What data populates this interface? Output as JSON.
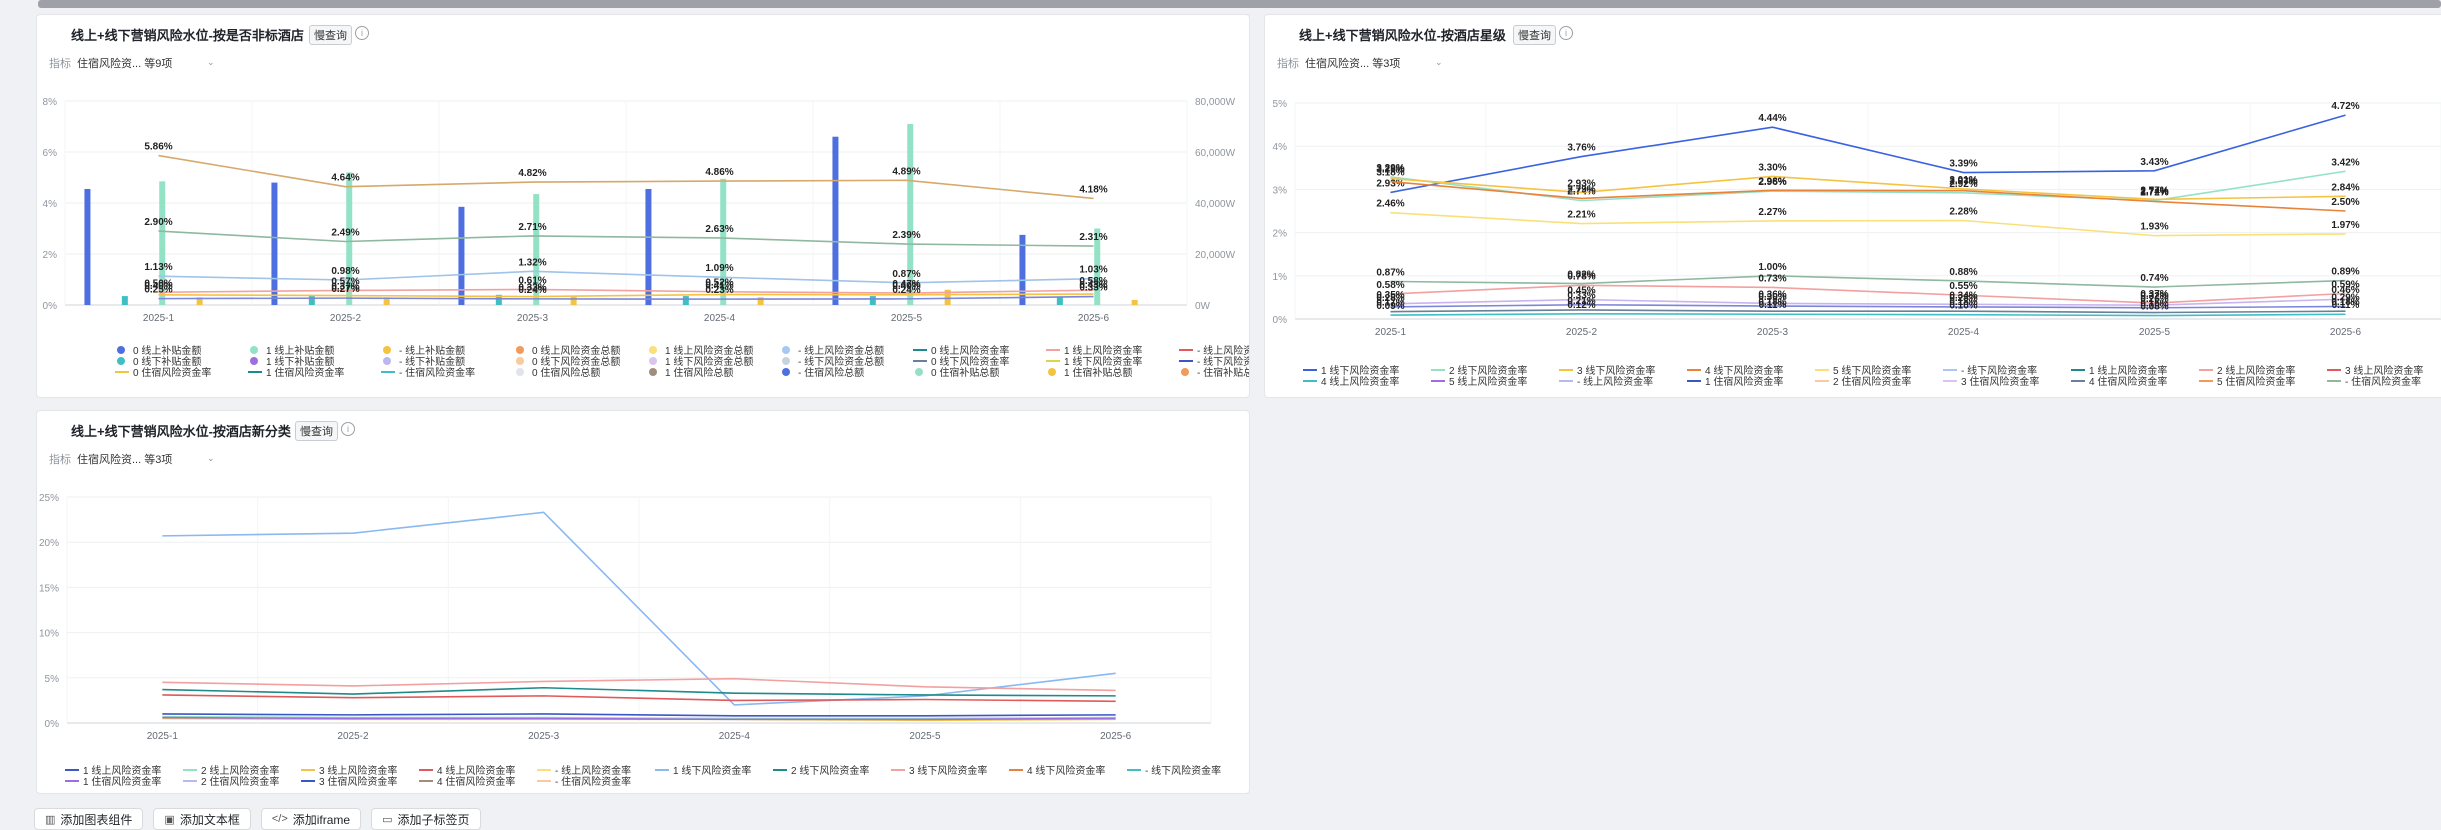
{
  "panels": [
    {
      "title": "线上+线下营销风险水位-按是否非标酒店",
      "badge": "慢查询",
      "filter_label": "指标",
      "filter_value": "住宿风险资... 等9项",
      "chart_data": {
        "type": "bar",
        "categories": [
          "2025-1",
          "2025-2",
          "2025-3",
          "2025-4",
          "2025-5",
          "2025-6"
        ],
        "ylim": [
          0,
          8
        ],
        "yticks": [
          "0%",
          "2%",
          "4%",
          "6%",
          "8%"
        ],
        "y2lim": [
          0,
          80000
        ],
        "y2ticks": [
          "0W",
          "20,000W",
          "40,000W",
          "60,000W",
          "80,000W"
        ],
        "bar_series": [
          {
            "name": "0 线上补贴金额",
            "color": "#4e6fe0",
            "values": [
              45500,
              48000,
              38500,
              45500,
              66000,
              27500
            ]
          },
          {
            "name": "0 线下补贴金额",
            "color": "#3fbfc4",
            "values": [
              3500,
              3500,
              4000,
              3500,
              3500,
              3000
            ]
          },
          {
            "name": "1 线上补贴金额",
            "color": "#93e2c6",
            "values": [
              48500,
              52000,
              43500,
              49500,
              71000,
              30000
            ]
          },
          {
            "name": "1 线下补贴金额",
            "color": "#f5c342",
            "values": [
              3000,
              3000,
              3500,
              3000,
              6000,
              2000
            ]
          }
        ],
        "line_series": [
          {
            "name": "住宿风险资金率",
            "color": "#d6a86a",
            "values": [
              5.86,
              4.64,
              4.82,
              4.86,
              4.89,
              4.18
            ],
            "labels": [
              "5.86%",
              "4.64%",
              "4.82%",
              "4.86%",
              "4.89%",
              "4.18%"
            ]
          },
          {
            "name": "1 线上风险资金率",
            "color": "#8fb89f",
            "values": [
              2.9,
              2.49,
              2.71,
              2.63,
              2.39,
              2.31
            ],
            "labels": [
              "2.90%",
              "2.49%",
              "2.71%",
              "2.63%",
              "2.39%",
              "2.31%"
            ]
          },
          {
            "name": "0 线上风险资金率",
            "color": "#9fc3ea",
            "values": [
              1.13,
              0.98,
              1.32,
              1.09,
              0.87,
              1.03
            ],
            "labels": [
              "1.13%",
              "0.98%",
              "1.32%",
              "1.09%",
              "0.87%",
              "1.03%"
            ]
          },
          {
            "name": "- 线上风险资金率",
            "color": "#f2a0a0",
            "values": [
              0.5,
              0.57,
              0.61,
              0.52,
              0.47,
              0.58
            ],
            "labels": [
              "0.50%",
              "0.57%",
              "0.61%",
              "0.52%",
              "0.47%",
              "0.58%"
            ]
          },
          {
            "name": "住宿风险资金率",
            "color": "#f5c342",
            "values": [
              0.4,
              0.37,
              0.33,
              0.41,
              0.4,
              0.43
            ],
            "labels": [
              "0.40%",
              "0.37%",
              "0.33%",
              "0.41%",
              "0.40%",
              "0.43%"
            ]
          },
          {
            "name": "- 线下风险资金率",
            "color": "#7b86d9",
            "values": [
              0.25,
              0.27,
              0.24,
              0.23,
              0.24,
              0.33
            ],
            "labels": [
              "0.25%",
              "0.27%",
              "0.24%",
              "0.23%",
              "0.24%",
              "0.33%"
            ]
          }
        ],
        "legend": [
          {
            "name": "0 线上补贴金额",
            "color": "#4e6fe0",
            "shape": "dot"
          },
          {
            "name": "1 线上补贴金额",
            "color": "#93e2c6",
            "shape": "dot"
          },
          {
            "name": "- 线上补贴金额",
            "color": "#f5c342",
            "shape": "dot"
          },
          {
            "name": "0 线上风险资金总额",
            "color": "#f29a5a",
            "shape": "dot"
          },
          {
            "name": "1 线上风险资金总额",
            "color": "#f9e07a",
            "shape": "dot"
          },
          {
            "name": "- 线上风险资金总额",
            "color": "#a8c7f5",
            "shape": "dot"
          },
          {
            "name": "0 线上风险资金率",
            "color": "#1f8a8a",
            "shape": "line"
          },
          {
            "name": "1 线上风险资金率",
            "color": "#f2a0a0",
            "shape": "line"
          },
          {
            "name": "- 线上风险资金率",
            "color": "#e05a5a",
            "shape": "line"
          },
          {
            "name": "0 线下补贴金额",
            "color": "#3fbfc4",
            "shape": "dot"
          },
          {
            "name": "1 线下补贴金额",
            "color": "#9b6fe0",
            "shape": "dot"
          },
          {
            "name": "- 线下补贴金额",
            "color": "#bdb7f0",
            "shape": "dot"
          },
          {
            "name": "0 线下风险资金总额",
            "color": "#f9c9a0",
            "shape": "dot"
          },
          {
            "name": "1 线下风险资金总额",
            "color": "#d8c6f0",
            "shape": "dot"
          },
          {
            "name": "- 线下风险资金总额",
            "color": "#c9d3e0",
            "shape": "dot"
          },
          {
            "name": "0 线下风险资金率",
            "color": "#6a7f99",
            "shape": "line"
          },
          {
            "name": "1 线下风险资金率",
            "color": "#e0d24a",
            "shape": "line"
          },
          {
            "name": "- 线下风险资金率",
            "color": "#3a57c4",
            "shape": "line"
          },
          {
            "name": "0 住宿风险资金率",
            "color": "#f5c342",
            "shape": "line"
          },
          {
            "name": "1 住宿风险资金率",
            "color": "#1f8a8a",
            "shape": "line"
          },
          {
            "name": "- 住宿风险资金率",
            "color": "#3fbfc4",
            "shape": "line"
          },
          {
            "name": "0 住宿风险总额",
            "color": "#e0e3e8",
            "shape": "dot"
          },
          {
            "name": "1 住宿风险总额",
            "color": "#a08e7a",
            "shape": "dot"
          },
          {
            "name": "- 住宿风险总额",
            "color": "#4e6fe0",
            "shape": "dot"
          },
          {
            "name": "0 住宿补贴总额",
            "color": "#93e2c6",
            "shape": "dot"
          },
          {
            "name": "1 住宿补贴总额",
            "color": "#f5c342",
            "shape": "dot"
          },
          {
            "name": "- 住宿补贴总额",
            "color": "#f29a5a",
            "shape": "dot"
          }
        ]
      }
    },
    {
      "title": "线上+线下营销风险水位-按酒店星级",
      "badge": "慢查询",
      "filter_label": "指标",
      "filter_value": "住宿风险资... 等3项",
      "chart_data": {
        "type": "line",
        "categories": [
          "2025-1",
          "2025-2",
          "2025-3",
          "2025-4",
          "2025-5",
          "2025-6"
        ],
        "ylim": [
          0,
          5
        ],
        "yticks": [
          "0%",
          "1%",
          "2%",
          "3%",
          "4%",
          "5%"
        ],
        "series": [
          {
            "name": "1 线下风险资金率",
            "color": "#3a62e0",
            "values": [
              2.93,
              3.76,
              4.44,
              3.39,
              3.43,
              4.72
            ],
            "labels": [
              "2.93%",
              "3.76%",
              "4.44%",
              "3.39%",
              "3.43%",
              "4.72%"
            ]
          },
          {
            "name": "2 线下风险资金率",
            "color": "#93e2c6",
            "values": [
              3.29,
              2.74,
              2.96,
              2.92,
              2.74,
              3.42
            ],
            "labels": [
              "3.29%",
              "2.74%",
              "2.96%",
              "2.92%",
              "2.74%",
              "3.42%"
            ]
          },
          {
            "name": "3 线下风险资金率",
            "color": "#f5c342",
            "values": [
              3.25,
              2.93,
              3.3,
              3.01,
              2.77,
              2.84
            ],
            "labels": [
              "3.25%",
              "2.93%",
              "3.30%",
              "3.01%",
              "2.77%",
              "2.84%"
            ]
          },
          {
            "name": "4 线下风险资金率",
            "color": "#e8833a",
            "values": [
              3.18,
              2.79,
              2.98,
              2.97,
              2.72,
              2.5
            ],
            "labels": [
              "3.18%",
              "2.79%",
              "2.98%",
              "2.97%",
              "2.72%",
              "2.50%"
            ]
          },
          {
            "name": "5 线下风险资金率",
            "color": "#f9e07a",
            "values": [
              2.46,
              2.21,
              2.27,
              2.28,
              1.93,
              1.97
            ],
            "labels": [
              "2.46%",
              "2.21%",
              "2.27%",
              "2.28%",
              "1.93%",
              "1.97%"
            ]
          },
          {
            "name": "1 住宿风险资金率",
            "color": "#8fb89f",
            "values": [
              0.87,
              0.82,
              1.0,
              0.88,
              0.74,
              0.89
            ],
            "labels": [
              "0.87%",
              "0.82%",
              "1.00%",
              "0.88%",
              "0.74%",
              "0.89%"
            ]
          },
          {
            "name": "2 住宿风险资金率",
            "color": "#f2a0a0",
            "values": [
              0.58,
              0.78,
              0.73,
              0.55,
              0.37,
              0.59
            ],
            "labels": [
              "0.58%",
              "0.78%",
              "0.73%",
              "0.55%",
              "0.37%",
              "0.59%"
            ]
          },
          {
            "name": "3 住宿风险资金率",
            "color": "#c9b3f0",
            "values": [
              0.35,
              0.45,
              0.36,
              0.34,
              0.32,
              0.46
            ],
            "labels": [
              "0.35%",
              "0.45%",
              "0.36%",
              "0.34%",
              "0.32%",
              "0.46%"
            ]
          },
          {
            "name": "4 住宿风险资金率",
            "color": "#7b86d9",
            "values": [
              0.28,
              0.33,
              0.3,
              0.28,
              0.26,
              0.29
            ],
            "labels": [
              "0.28%",
              "0.33%",
              "0.30%",
              "0.28%",
              "0.26%",
              "0.29%"
            ]
          },
          {
            "name": "5 住宿风险资金率",
            "color": "#6a7f99",
            "values": [
              0.17,
              0.21,
              0.18,
              0.18,
              0.15,
              0.18
            ],
            "labels": [
              "0.17%",
              "0.21%",
              "0.18%",
              "0.18%",
              "0.15%",
              "0.18%"
            ]
          },
          {
            "name": "- 住宿风险资金率",
            "color": "#3fbfc4",
            "values": [
              0.09,
              0.12,
              0.11,
              0.1,
              0.08,
              0.11
            ],
            "labels": [
              "0.09%",
              "0.12%",
              "0.11%",
              "0.10%",
              "0.08%",
              "0.11%"
            ]
          }
        ],
        "legend": [
          {
            "name": "1 线下风险资金率",
            "color": "#3a62e0"
          },
          {
            "name": "2 线下风险资金率",
            "color": "#93e2c6"
          },
          {
            "name": "3 线下风险资金率",
            "color": "#f5c342"
          },
          {
            "name": "4 线下风险资金率",
            "color": "#e8833a"
          },
          {
            "name": "5 线下风险资金率",
            "color": "#f9e07a"
          },
          {
            "name": "- 线下风险资金率",
            "color": "#a8c7f5"
          },
          {
            "name": "1 线上风险资金率",
            "color": "#1f8a8a"
          },
          {
            "name": "2 线上风险资金率",
            "color": "#f2a0a0"
          },
          {
            "name": "3 线上风险资金率",
            "color": "#e05a5a"
          },
          {
            "name": "4 线上风险资金率",
            "color": "#3fbfc4"
          },
          {
            "name": "5 线上风险资金率",
            "color": "#9b6fe0"
          },
          {
            "name": "- 线上风险资金率",
            "color": "#bdb7f0"
          },
          {
            "name": "1 住宿风险资金率",
            "color": "#3a57c4"
          },
          {
            "name": "2 住宿风险资金率",
            "color": "#f9c9a0"
          },
          {
            "name": "3 住宿风险资金率",
            "color": "#d8c6f0"
          },
          {
            "name": "4 住宿风险资金率",
            "color": "#6a7f99"
          },
          {
            "name": "5 住宿风险资金率",
            "color": "#f29a5a"
          },
          {
            "name": "- 住宿风险资金率",
            "color": "#8fb89f"
          }
        ]
      }
    },
    {
      "title": "线上+线下营销风险水位-按酒店新分类",
      "badge": "慢查询",
      "filter_label": "指标",
      "filter_value": "住宿风险资... 等3项",
      "chart_data": {
        "type": "line",
        "categories": [
          "2025-1",
          "2025-2",
          "2025-3",
          "2025-4",
          "2025-5",
          "2025-6"
        ],
        "ylim": [
          0,
          25
        ],
        "yticks": [
          "0%",
          "5%",
          "10%",
          "15%",
          "20%",
          "25%"
        ],
        "series": [
          {
            "name": "- 线下风险资金率",
            "color": "#8ab8f0",
            "values": [
              20.7,
              21.0,
              23.3,
              2.0,
              3.0,
              5.5
            ]
          },
          {
            "name": "1 线下风险资金率",
            "color": "#f2a0a0",
            "values": [
              4.5,
              4.1,
              4.6,
              4.9,
              4.0,
              3.6
            ]
          },
          {
            "name": "2 线下风险资金率",
            "color": "#1f8a8a",
            "values": [
              3.7,
              3.2,
              3.9,
              3.3,
              3.1,
              3.0
            ]
          },
          {
            "name": "3 线下风险资金率",
            "color": "#e05a5a",
            "values": [
              3.1,
              2.8,
              3.0,
              2.5,
              2.6,
              2.4
            ]
          },
          {
            "name": "1 线上风险资金率",
            "color": "#3a57c4",
            "values": [
              1.0,
              0.9,
              1.0,
              0.8,
              0.8,
              0.9
            ]
          },
          {
            "name": "2 线上风险资金率",
            "color": "#93e2c6",
            "values": [
              0.7,
              0.6,
              0.6,
              0.5,
              0.5,
              0.6
            ]
          },
          {
            "name": "3 线上风险资金率",
            "color": "#f5c342",
            "values": [
              0.5,
              0.4,
              0.4,
              0.4,
              0.3,
              0.4
            ]
          },
          {
            "name": "1 住宿风险资金率",
            "color": "#9b6fe0",
            "values": [
              0.6,
              0.5,
              0.5,
              0.4,
              0.4,
              0.5
            ]
          }
        ],
        "legend": [
          {
            "name": "1 线上风险资金率",
            "color": "#3a57c4"
          },
          {
            "name": "2 线上风险资金率",
            "color": "#93e2c6"
          },
          {
            "name": "3 线上风险资金率",
            "color": "#f5c342"
          },
          {
            "name": "4 线上风险资金率",
            "color": "#e05a5a"
          },
          {
            "name": "- 线上风险资金率",
            "color": "#f9e07a"
          },
          {
            "name": "1 线下风险资金率",
            "color": "#8ab8f0"
          },
          {
            "name": "2 线下风险资金率",
            "color": "#1f8a8a"
          },
          {
            "name": "3 线下风险资金率",
            "color": "#f2a0a0"
          },
          {
            "name": "4 线下风险资金率",
            "color": "#e8833a"
          },
          {
            "name": "- 线下风险资金率",
            "color": "#3fbfc4"
          },
          {
            "name": "1 住宿风险资金率",
            "color": "#9b6fe0"
          },
          {
            "name": "2 住宿风险资金率",
            "color": "#bdb7f0"
          },
          {
            "name": "3 住宿风险资金率",
            "color": "#3a57c4"
          },
          {
            "name": "4 住宿风险资金率",
            "color": "#a08e7a"
          },
          {
            "name": "- 住宿风险资金率",
            "color": "#f9c9a0"
          }
        ]
      }
    }
  ],
  "toolbar": [
    {
      "label": "添加图表组件",
      "icon": "chart-icon"
    },
    {
      "label": "添加文本框",
      "icon": "textbox-icon"
    },
    {
      "label": "添加iframe",
      "icon": "code-icon"
    },
    {
      "label": "添加子标签页",
      "icon": "tab-icon"
    }
  ]
}
